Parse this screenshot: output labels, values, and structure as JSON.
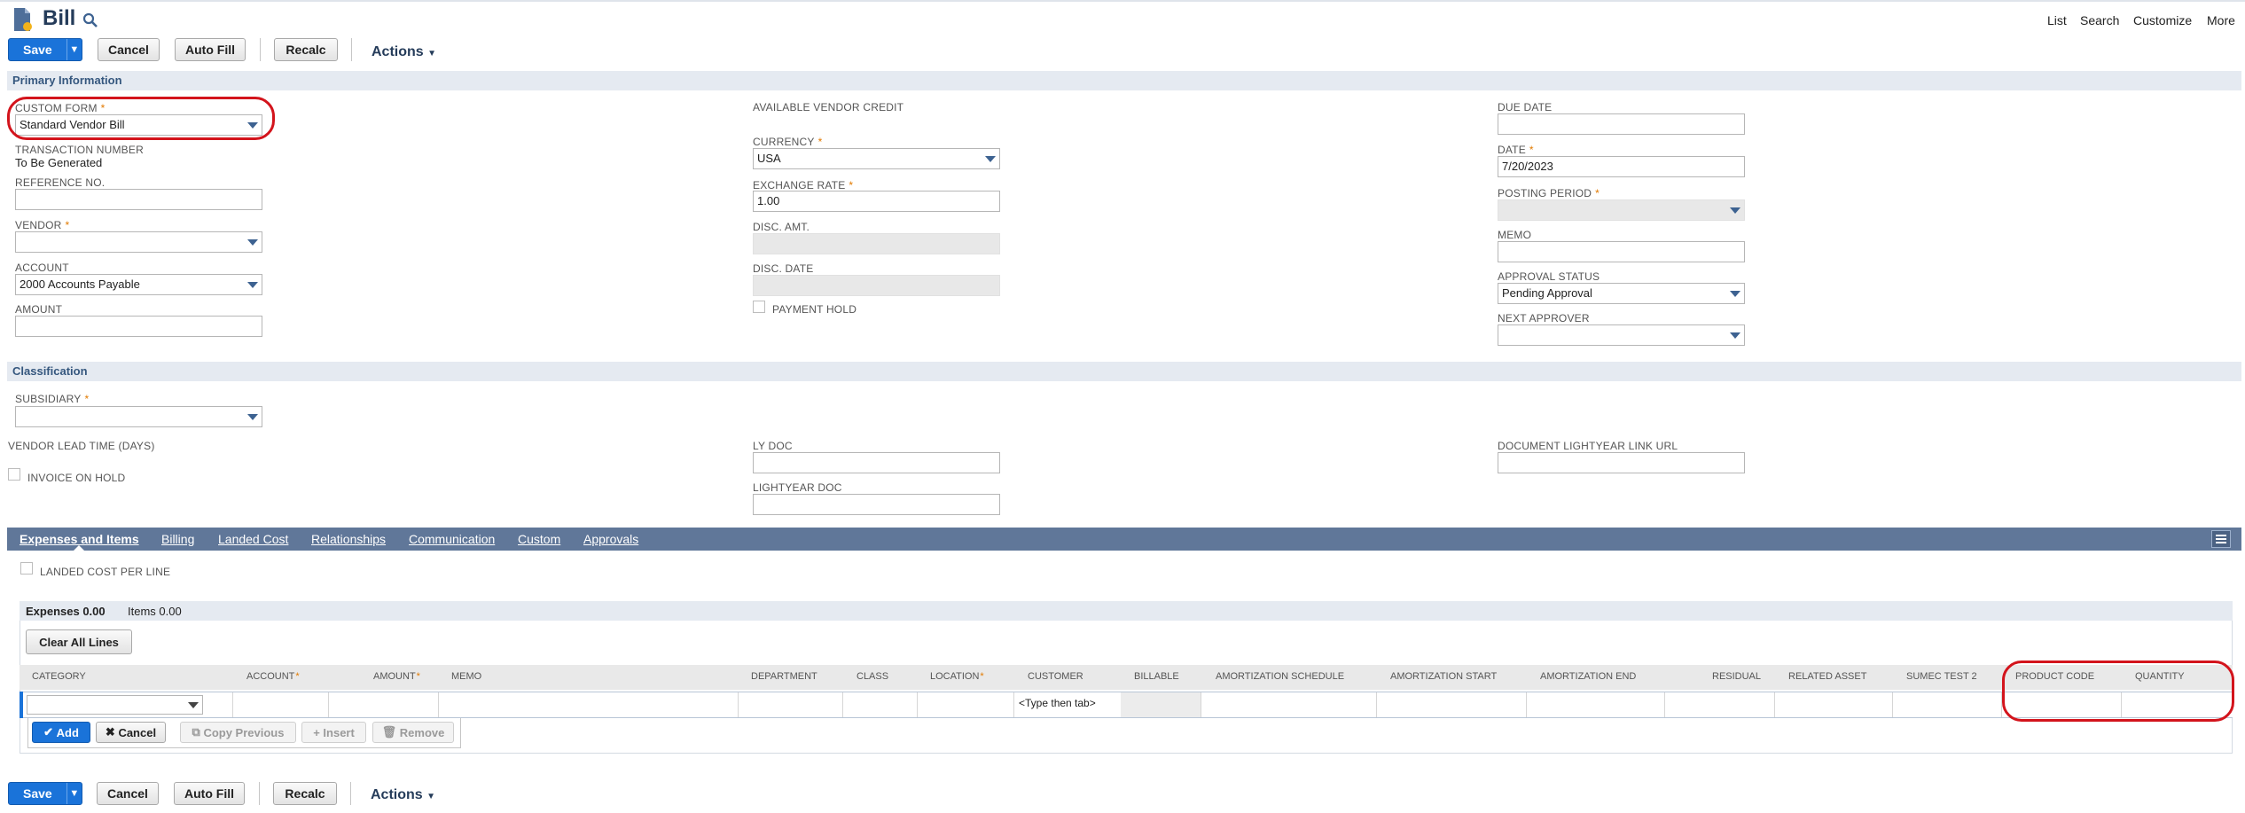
{
  "page": {
    "title": "Bill"
  },
  "top_nav": [
    "List",
    "Search",
    "Customize",
    "More"
  ],
  "toolbar": {
    "save": "Save",
    "cancel": "Cancel",
    "autofill": "Auto Fill",
    "recalc": "Recalc",
    "actions": "Actions"
  },
  "sections": {
    "primary": "Primary Information",
    "classification": "Classification"
  },
  "primary": {
    "custom_form": {
      "label": "CUSTOM FORM",
      "value": "Standard Vendor Bill"
    },
    "transaction_number": {
      "label": "TRANSACTION NUMBER",
      "value": "To Be Generated"
    },
    "reference_no": {
      "label": "REFERENCE NO.",
      "value": ""
    },
    "vendor": {
      "label": "VENDOR",
      "value": ""
    },
    "account": {
      "label": "ACCOUNT",
      "value": "2000 Accounts Payable"
    },
    "amount": {
      "label": "AMOUNT",
      "value": ""
    },
    "available_vendor_credit": {
      "label": "AVAILABLE VENDOR CREDIT"
    },
    "currency": {
      "label": "CURRENCY",
      "value": "USA"
    },
    "exchange_rate": {
      "label": "EXCHANGE RATE",
      "value": "1.00"
    },
    "disc_amt": {
      "label": "DISC. AMT."
    },
    "disc_date": {
      "label": "DISC. DATE"
    },
    "payment_hold": {
      "label": "PAYMENT HOLD",
      "checked": false
    },
    "due_date": {
      "label": "DUE DATE",
      "value": ""
    },
    "date": {
      "label": "DATE",
      "value": "7/20/2023"
    },
    "posting_period": {
      "label": "POSTING PERIOD",
      "value": ""
    },
    "memo": {
      "label": "MEMO",
      "value": ""
    },
    "approval_status": {
      "label": "APPROVAL STATUS",
      "value": "Pending Approval"
    },
    "next_approver": {
      "label": "NEXT APPROVER",
      "value": ""
    }
  },
  "classification": {
    "subsidiary": {
      "label": "SUBSIDIARY",
      "value": ""
    },
    "vendor_lead_time": {
      "label": "VENDOR LEAD TIME (DAYS)"
    },
    "invoice_on_hold": {
      "label": "INVOICE ON HOLD",
      "checked": false
    },
    "ly_doc": {
      "label": "LY DOC",
      "value": ""
    },
    "lightyear_doc": {
      "label": "LIGHTYEAR DOC",
      "value": ""
    },
    "doc_link_url": {
      "label": "DOCUMENT LIGHTYEAR LINK URL",
      "value": ""
    }
  },
  "tabs": [
    {
      "label": "Expenses and Items",
      "active": true
    },
    {
      "label": "Billing"
    },
    {
      "label": "Landed Cost"
    },
    {
      "label": "Relationships"
    },
    {
      "label": "Communication"
    },
    {
      "label": "Custom"
    },
    {
      "label": "Approvals"
    }
  ],
  "landed_cost_per_line": {
    "label": "LANDED COST PER LINE",
    "checked": false
  },
  "subtabs": {
    "expenses": "Expenses 0.00",
    "items": "Items 0.00"
  },
  "clear_all_lines": "Clear All Lines",
  "columns": [
    "CATEGORY",
    "ACCOUNT",
    "AMOUNT",
    "MEMO",
    "DEPARTMENT",
    "CLASS",
    "LOCATION",
    "CUSTOMER",
    "BILLABLE",
    "AMORTIZATION SCHEDULE",
    "AMORTIZATION START",
    "AMORTIZATION END",
    "RESIDUAL",
    "RELATED ASSET",
    "SUMEC TEST 2",
    "PRODUCT CODE",
    "QUANTITY"
  ],
  "row": {
    "customer_hint": "<Type then tab>"
  },
  "line_buttons": {
    "add": "Add",
    "cancel": "Cancel",
    "copy_previous": "Copy Previous",
    "insert": "Insert",
    "remove": "Remove"
  },
  "colors": {
    "accent": "#1a73d9",
    "tabbar": "#607799",
    "section_bg": "#e5eaf1",
    "highlight": "#d3141c"
  }
}
